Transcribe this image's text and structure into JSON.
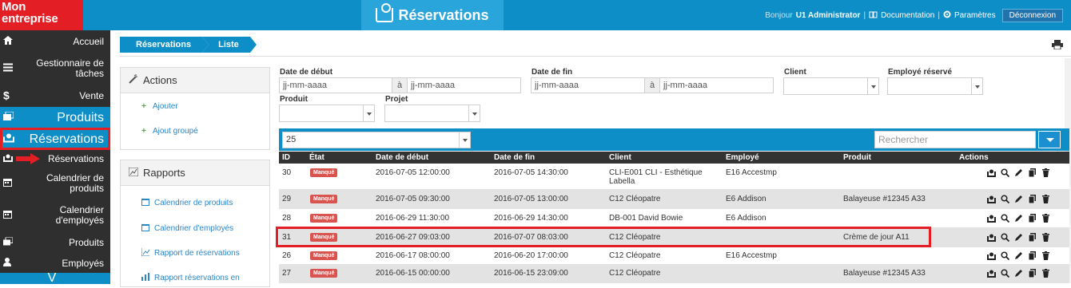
{
  "header": {
    "logo_line1": "Mon",
    "logo_line2": "entreprise",
    "app_title": "Réservations",
    "greeting": "Bonjour",
    "user": "U1 Administrator",
    "documentation": "Documentation",
    "settings": "Paramètres",
    "logout": "Déconnexion"
  },
  "sidebar": {
    "items": [
      {
        "label": "Accueil",
        "icon": "home-icon"
      },
      {
        "label": "Gestionnaire de tâches",
        "icon": "tasks-icon"
      },
      {
        "label": "Vente",
        "icon": "dollar-icon"
      },
      {
        "label": "Produits",
        "icon": "products-icon"
      },
      {
        "label": "Réservations",
        "icon": "tray-icon"
      },
      {
        "label": "Réservations",
        "icon": "tray-icon"
      },
      {
        "label": "Calendrier de produits",
        "icon": "calendar-icon"
      },
      {
        "label": "Calendrier d'employés",
        "icon": "calendar-icon"
      },
      {
        "label": "Produits",
        "icon": "products-icon"
      },
      {
        "label": "Employés",
        "icon": "user-icon"
      },
      {
        "label": "V"
      }
    ]
  },
  "breadcrumb": [
    "Réservations",
    "Liste"
  ],
  "panels": {
    "actions_title": "Actions",
    "actions": [
      "Ajouter",
      "Ajout groupé"
    ],
    "reports_title": "Rapports",
    "reports": [
      "Calendrier de produits",
      "Calendrier d'employés",
      "Rapport de réservations",
      "Rapport réservations en"
    ]
  },
  "filters": {
    "start_label": "Date de début",
    "end_label": "Date de fin",
    "client_label": "Client",
    "employee_label": "Employé réservé",
    "product_label": "Produit",
    "project_label": "Projet",
    "date_placeholder": "jj-mm-aaaa",
    "range_sep": "à"
  },
  "table_toolbar": {
    "page_size": "25",
    "search_placeholder": "Rechercher"
  },
  "table": {
    "columns": [
      "ID",
      "État",
      "Date de début",
      "Date de fin",
      "Client",
      "Employé",
      "Produit",
      "Actions"
    ],
    "rows": [
      {
        "id": "30",
        "state": "Manqué",
        "start": "2016-07-05 12:00:00",
        "end": "2016-07-05 14:30:00",
        "client": "CLI-E001 CLI - Esthétique",
        "client2": "Labella",
        "employee": "E16 Accestmp",
        "product": ""
      },
      {
        "id": "29",
        "state": "Manqué",
        "start": "2016-07-05 09:30:00",
        "end": "2016-07-05 13:00:00",
        "client": "C12 Cléopatre",
        "client2": "",
        "employee": "E6 Addison",
        "product": "Balayeuse #12345 A33"
      },
      {
        "id": "28",
        "state": "Manqué",
        "start": "2016-06-29 11:30:00",
        "end": "2016-06-29 14:30:00",
        "client": "DB-001 David Bowie",
        "client2": "",
        "employee": "E6 Addison",
        "product": ""
      },
      {
        "id": "31",
        "state": "Manqué",
        "start": "2016-06-27 09:03:00",
        "end": "2016-07-07 08:03:00",
        "client": "C12 Cléopatre",
        "client2": "",
        "employee": "",
        "product": "Crème de jour A11"
      },
      {
        "id": "26",
        "state": "Manqué",
        "start": "2016-06-17 08:00:00",
        "end": "2016-06-20 17:00:00",
        "client": "C12 Cléopatre",
        "client2": "",
        "employee": "E16 Accestmp",
        "product": ""
      },
      {
        "id": "27",
        "state": "Manqué",
        "start": "2016-06-15 00:00:00",
        "end": "2016-06-15 23:09:00",
        "client": "C12 Cléopatre",
        "client2": "",
        "employee": "",
        "product": "Balayeuse #12345 A33"
      }
    ]
  },
  "colors": {
    "brand_blue": "#0e8ec6",
    "logo_red": "#e31e24",
    "sidebar_dark": "#2f2f2f",
    "badge_red": "#d9534f"
  }
}
